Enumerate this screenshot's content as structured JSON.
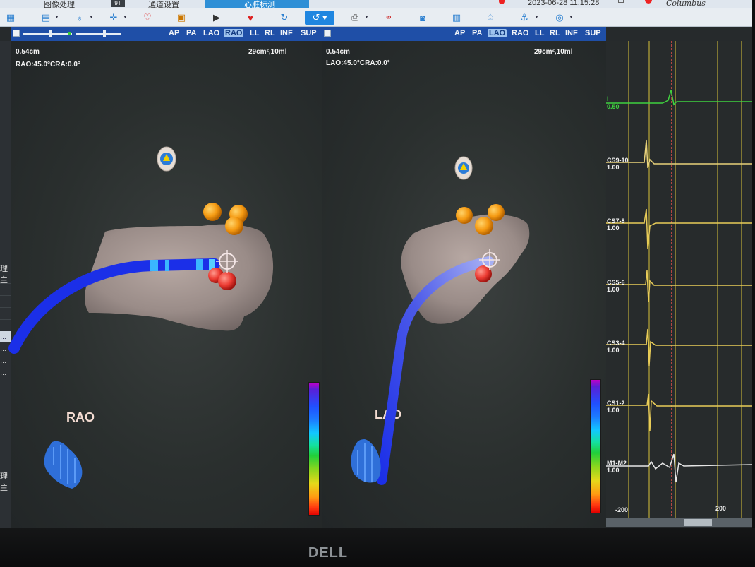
{
  "menu": {
    "items": [
      "图像处理",
      "通道设置",
      "心脏标测"
    ],
    "icon_box": "9T",
    "active": "心脏标测",
    "datetime": "2023-06-28 11:15:28",
    "brand": "Columbus"
  },
  "toolbar": {
    "icons": [
      "layout-icon",
      "panel-icon",
      "catheter-icon",
      "crosshair-icon",
      "heart-icon",
      "colormap-icon",
      "play-icon",
      "ecg-icon",
      "loop-icon",
      "catheter-curve-icon",
      "print-icon",
      "network-icon",
      "camera-icon",
      "report-icon",
      "lungs-icon",
      "anchor-icon",
      "target-icon"
    ]
  },
  "viewbars": {
    "left": {
      "views": [
        "AP",
        "PA",
        "LAO",
        "RAO",
        "LL",
        "RL",
        "INF",
        "SUP"
      ],
      "active": "RAO"
    },
    "right": {
      "views": [
        "AP",
        "PA",
        "LAO",
        "RAO",
        "LL",
        "RL",
        "INF",
        "SUP"
      ],
      "active": "LAO"
    },
    "signal_icons": [
      "align-icon",
      "bars-icon",
      "list-icon",
      "split-icon",
      "ruler-icon",
      "marker-icon",
      "grid-icon",
      "search-icon",
      "layers-icon"
    ]
  },
  "sidepanel": {
    "labels": [
      "理 主",
      "理 主"
    ]
  },
  "rao": {
    "scale": "0.54cm",
    "orientation": "RAO:45.0°CRA:0.0°",
    "area": "29cm²,10ml",
    "label": "RAO"
  },
  "lao": {
    "scale": "0.54cm",
    "orientation": "LAO:45.0°CRA:0.0°",
    "area": "29cm²,10ml",
    "label": "LAO"
  },
  "signals": {
    "channels": [
      {
        "name": "I",
        "gain": "0.50",
        "color": "#3fd23f"
      },
      {
        "name": "CS9-10",
        "gain": "1.00",
        "color": "#e8d27a"
      },
      {
        "name": "CS7-8",
        "gain": "1.00",
        "color": "#e8cc58"
      },
      {
        "name": "CS5-6",
        "gain": "1.00",
        "color": "#e8cc58"
      },
      {
        "name": "CS3-4",
        "gain": "1.00",
        "color": "#e8cc58"
      },
      {
        "name": "CS1-2",
        "gain": "1.00",
        "color": "#e8cc58"
      },
      {
        "name": "M1-M2",
        "gain": "1.00",
        "color": "#e6e6e6"
      }
    ],
    "axis": [
      "-200",
      "200"
    ]
  },
  "monitor": {
    "brand": "DELL"
  }
}
